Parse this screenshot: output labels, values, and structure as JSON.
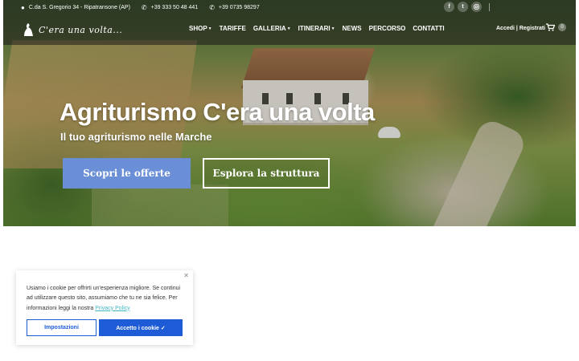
{
  "topbar": {
    "address": "C.da S. Gregorio 34 - Ripatransone (AP)",
    "phone_mobile": "+39 333 50 48 441",
    "phone_landline": "+39 0735 98297",
    "social": [
      "f",
      "t",
      "ig"
    ]
  },
  "logo": {
    "text": "C'era una volta..."
  },
  "menu": [
    {
      "label": "SHOP",
      "dropdown": true
    },
    {
      "label": "TARIFFE",
      "dropdown": false
    },
    {
      "label": "GALLERIA",
      "dropdown": true
    },
    {
      "label": "ITINERARI",
      "dropdown": true
    },
    {
      "label": "NEWS",
      "dropdown": false
    },
    {
      "label": "PERCORSO",
      "dropdown": false
    },
    {
      "label": "CONTATTI",
      "dropdown": false
    }
  ],
  "account": {
    "login": "Accedi",
    "separator": "|",
    "register": "Registrati"
  },
  "cart": {
    "count": "0"
  },
  "hero": {
    "title": "Agriturismo C'era una volta",
    "subtitle": "Il tuo agriturismo nelle Marche",
    "primary_button": "Scopri le offerte",
    "secondary_button": "Esplora la struttura"
  },
  "cookie": {
    "text": "Usiamo i cookie per offrirti un'esperienza migliore. Se continui ad utilizzare questo sito, assumiamo che tu ne sia felice. Per informazioni leggi la nostra",
    "link": "Privacy Policy",
    "settings_button": "Impostazioni",
    "accept_button": "Accetto i cookie ✓"
  },
  "colors": {
    "primary_button": "#6b8fd6",
    "cookie_blue": "#1e5bd6",
    "link": "#3fb8c4"
  }
}
